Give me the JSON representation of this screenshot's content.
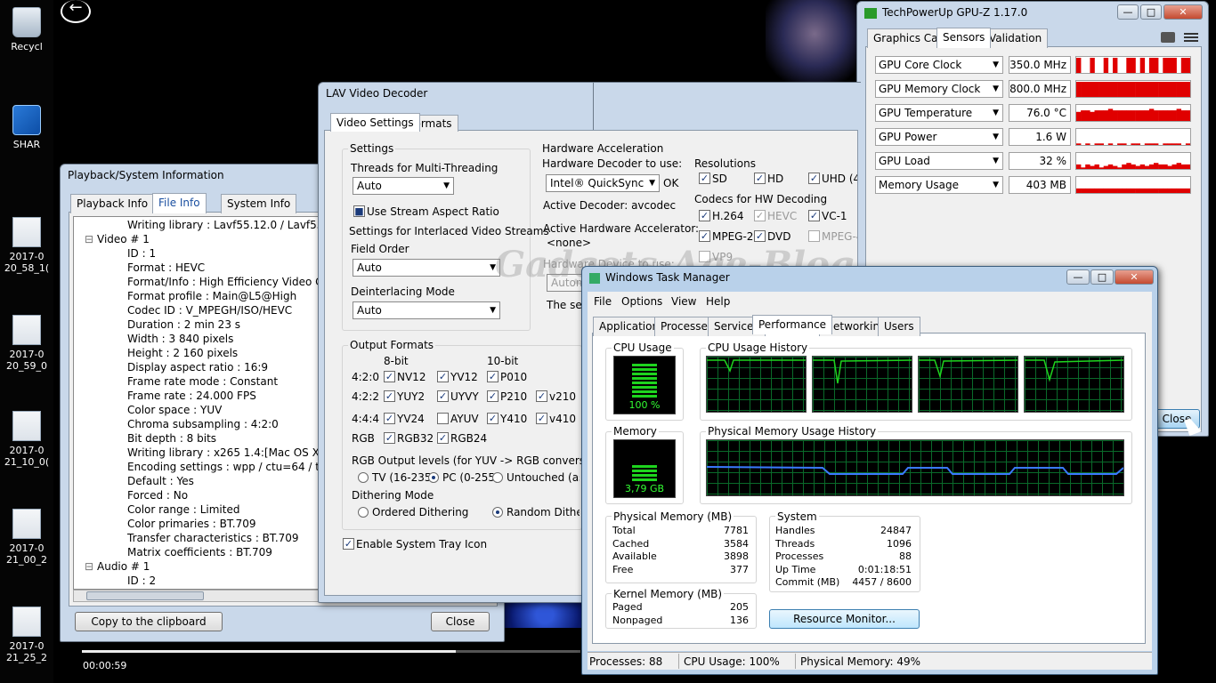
{
  "desktop": {
    "icons": [
      {
        "label": "Recycl"
      },
      {
        "label": "SHAR"
      },
      {
        "label": "2017-0",
        "label2": "20_58_1("
      },
      {
        "label": "2017-0",
        "label2": "20_59_0"
      },
      {
        "label": "2017-0",
        "label2": "21_10_0("
      },
      {
        "label": "2017-0",
        "label2": "21_00_2"
      },
      {
        "label": "2017-0",
        "label2": "21_25_2"
      }
    ],
    "player_time": "00:00:59",
    "player_progress": 0.75
  },
  "playback": {
    "title": "Playback/System Information",
    "tabs": [
      "Playback Info",
      "File Info",
      "System Info"
    ],
    "tree": [
      "Writing library : Lavf55.12.0 / Lavf55.12.0",
      "Video # 1",
      "ID : 1",
      "Format : HEVC",
      "Format/Info : High Efficiency Video Coding",
      "Format profile : Main@L5@High",
      "Codec ID : V_MPEGH/ISO/HEVC",
      "Duration : 2 min 23 s",
      "Width : 3 840 pixels",
      "Height : 2 160 pixels",
      "Display aspect ratio : 16:9",
      "Frame rate mode : Constant",
      "Frame rate : 24.000 FPS",
      "Color space : YUV",
      "Chroma subsampling : 4:2:0",
      "Bit depth : 8 bits",
      "Writing library : x265 1.4:[Mac OS X][cla",
      "Encoding settings : wpp / ctu=64 / tu-int",
      "Default : Yes",
      "Forced : No",
      "Color range : Limited",
      "Color primaries : BT.709",
      "Transfer characteristics : BT.709",
      "Matrix coefficients : BT.709",
      "Audio # 1",
      "ID : 2"
    ],
    "copy_label": "Copy to the clipboard",
    "close_label": "Close"
  },
  "lav": {
    "title": "LAV Video Decoder",
    "tabs": [
      "Video Settings",
      "Formats"
    ],
    "settings_group": "Settings",
    "threads_label": "Threads for Multi-Threading",
    "threads_value": "Auto",
    "stream_aspect": "Use Stream Aspect Ratio",
    "interlaced_label": "Settings for Interlaced Video Streams",
    "field_order_label": "Field Order",
    "field_order_value": "Auto",
    "deint_label": "Deinterlacing Mode",
    "deint_value": "Auto",
    "hwaccel_group": "Hardware Acceleration",
    "hw_decoder_label": "Hardware Decoder to use:",
    "hw_decoder_value": "Intel® QuickSync",
    "hw_ok": "OK",
    "active_decoder": "Active Decoder:  avcodec",
    "active_hw_label": "Active Hardware Accelerator:",
    "active_hw_value": "<none>",
    "hw_device_label": "Hardware Device to use:",
    "hw_device_value": "Autom",
    "sel_text": "The sele",
    "resolutions_label": "Resolutions",
    "res": [
      "SD",
      "HD",
      "UHD (4K"
    ],
    "codecs_label": "Codecs for HW Decoding",
    "codecs": [
      "H.264",
      "HEVC",
      "VC-1",
      "MPEG-2",
      "DVD",
      "MPEG-4",
      "VP9"
    ],
    "output_group": "Output Formats",
    "bit8": "8-bit",
    "bit10": "10-bit",
    "fmt_rows": [
      "4:2:0",
      "4:2:2",
      "4:4:4",
      "RGB"
    ],
    "fmts": [
      "NV12",
      "YV12",
      "P010",
      "YUY2",
      "UYVY",
      "P210",
      "v210",
      "YV24",
      "AYUV",
      "Y410",
      "v410",
      "RGB32",
      "RGB24"
    ],
    "rgb_levels_label": "RGB Output levels (for YUV -> RGB conversion)",
    "rgb_levels": [
      "TV (16-235)",
      "PC (0-255)",
      "Untouched (as in"
    ],
    "dither_label": "Dithering Mode",
    "dither": [
      "Ordered Dithering",
      "Random Dithering"
    ],
    "tray": "Enable System Tray Icon"
  },
  "gpuz": {
    "title": "TechPowerUp GPU-Z 1.17.0",
    "tabs": [
      "Graphics Card",
      "Sensors",
      "Validation"
    ],
    "sensors": [
      {
        "name": "GPU Core Clock",
        "value": "350.0 MHz"
      },
      {
        "name": "GPU Memory Clock",
        "value": "800.0 MHz"
      },
      {
        "name": "GPU Temperature",
        "value": "76.0 °C"
      },
      {
        "name": "GPU Power",
        "value": "1.6 W"
      },
      {
        "name": "GPU Load",
        "value": "32 %"
      },
      {
        "name": "Memory Usage",
        "value": "403 MB"
      }
    ],
    "close_label": "Close"
  },
  "taskman": {
    "title": "Windows Task Manager",
    "menu": [
      "File",
      "Options",
      "View",
      "Help"
    ],
    "tabs": [
      "Applications",
      "Processes",
      "Services",
      "Performance",
      "Networking",
      "Users"
    ],
    "cpu_usage_label": "CPU Usage",
    "cpu_usage_value": "100 %",
    "cpu_history_label": "CPU Usage History",
    "memory_label": "Memory",
    "memory_value": "3,79 GB",
    "mem_history_label": "Physical Memory Usage History",
    "phys_mem_label": "Physical Memory (MB)",
    "phys_mem": [
      [
        "Total",
        "7781"
      ],
      [
        "Cached",
        "3584"
      ],
      [
        "Available",
        "3898"
      ],
      [
        "Free",
        "377"
      ]
    ],
    "kernel_label": "Kernel Memory (MB)",
    "kernel": [
      [
        "Paged",
        "205"
      ],
      [
        "Nonpaged",
        "136"
      ]
    ],
    "system_label": "System",
    "system": [
      [
        "Handles",
        "24847"
      ],
      [
        "Threads",
        "1096"
      ],
      [
        "Processes",
        "88"
      ],
      [
        "Up Time",
        "0:01:18:51"
      ],
      [
        "Commit (MB)",
        "4457 / 8600"
      ]
    ],
    "resource_monitor": "Resource Monitor...",
    "status": [
      "Processes: 88",
      "CPU Usage: 100%",
      "Physical Memory: 49%"
    ]
  },
  "watermark": "Gadgets-Age-Blog",
  "colors": {
    "graph_green": "#1ed41e",
    "graph_blue": "#3a7aff",
    "gpuz_red": "#e00000"
  }
}
